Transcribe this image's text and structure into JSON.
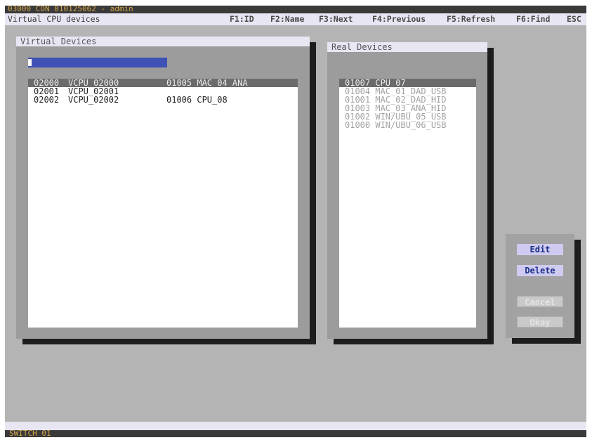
{
  "header": {
    "session_title": "03000 CON 010125062 - admin",
    "screen_title": "Virtual CPU devices"
  },
  "fkeys": [
    {
      "label": "F1:ID"
    },
    {
      "label": "F2:Name"
    },
    {
      "label": "F3:Next"
    },
    {
      "label": "F4:Previous"
    },
    {
      "label": "F5:Refresh"
    },
    {
      "label": "F6:Find"
    },
    {
      "label": "ESC"
    }
  ],
  "virtual_panel": {
    "title": "Virtual Devices",
    "search_value": "",
    "rows": [
      {
        "id": "02000",
        "name": "VCPU_02000",
        "assigned": "01005 MAC_04_ANA",
        "selected": true
      },
      {
        "id": "02001",
        "name": "VCPU_02001",
        "assigned": "",
        "selected": false
      },
      {
        "id": "02002",
        "name": "VCPU_02002",
        "assigned": "01006 CPU_08",
        "selected": false
      }
    ]
  },
  "real_panel": {
    "title": "Real Devices",
    "rows": [
      {
        "text": "01007 CPU_07",
        "selected": true
      },
      {
        "text": "01004 MAC_01_DAD_USB",
        "selected": false
      },
      {
        "text": "01001 MAC_02_DAD_HID",
        "selected": false
      },
      {
        "text": "01003 MAC_03_ANA_HID",
        "selected": false
      },
      {
        "text": "01002 WIN/UBU_05_USB",
        "selected": false
      },
      {
        "text": "01000 WIN/UBU_06_USB",
        "selected": false
      }
    ]
  },
  "actions": {
    "edit": "Edit",
    "delete": "Delete",
    "cancel": "Cancel",
    "okay": "Okay"
  },
  "footer": {
    "status": "SWITCH 01"
  },
  "colors": {
    "background": "#b4b4b4",
    "title_text": "#d2a24a",
    "selection": "#6b6b6b",
    "search_field": "#3f51b5",
    "button_active": "#cfcbf0"
  }
}
